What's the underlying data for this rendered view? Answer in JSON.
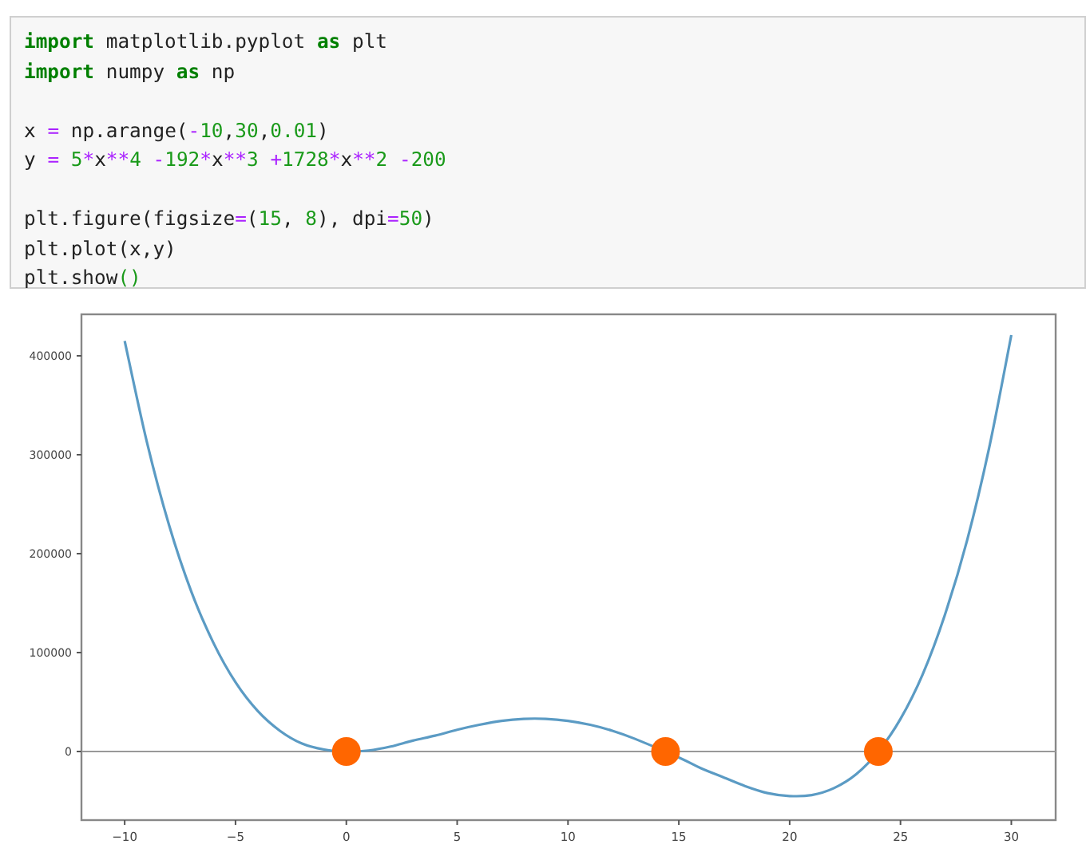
{
  "code_cell": {
    "blocks": [
      [
        [
          {
            "kind": "keyword",
            "text": "import"
          },
          {
            "kind": "plain",
            "text": " matplotlib.pyplot "
          },
          {
            "kind": "keyword",
            "text": "as"
          },
          {
            "kind": "plain",
            "text": " plt"
          }
        ],
        [
          {
            "kind": "keyword",
            "text": "import"
          },
          {
            "kind": "plain",
            "text": " numpy "
          },
          {
            "kind": "keyword",
            "text": "as"
          },
          {
            "kind": "plain",
            "text": " np"
          }
        ]
      ],
      [
        [
          {
            "kind": "plain",
            "text": "x "
          },
          {
            "kind": "operator",
            "text": "="
          },
          {
            "kind": "plain",
            "text": " np.arange("
          },
          {
            "kind": "operator",
            "text": "-"
          },
          {
            "kind": "number",
            "text": "10"
          },
          {
            "kind": "plain",
            "text": ","
          },
          {
            "kind": "number",
            "text": "30"
          },
          {
            "kind": "plain",
            "text": ","
          },
          {
            "kind": "number",
            "text": "0.01"
          },
          {
            "kind": "plain",
            "text": ")"
          }
        ],
        [
          {
            "kind": "plain",
            "text": "y "
          },
          {
            "kind": "operator",
            "text": "="
          },
          {
            "kind": "number",
            "text": " 5"
          },
          {
            "kind": "operator",
            "text": "*"
          },
          {
            "kind": "plain",
            "text": "x"
          },
          {
            "kind": "operator",
            "text": "**"
          },
          {
            "kind": "number",
            "text": "4"
          },
          {
            "kind": "operator",
            "text": " -"
          },
          {
            "kind": "number",
            "text": "192"
          },
          {
            "kind": "operator",
            "text": "*"
          },
          {
            "kind": "plain",
            "text": "x"
          },
          {
            "kind": "operator",
            "text": "**"
          },
          {
            "kind": "number",
            "text": "3"
          },
          {
            "kind": "operator",
            "text": " +"
          },
          {
            "kind": "number",
            "text": "1728"
          },
          {
            "kind": "operator",
            "text": "*"
          },
          {
            "kind": "plain",
            "text": "x"
          },
          {
            "kind": "operator",
            "text": "**"
          },
          {
            "kind": "number",
            "text": "2"
          },
          {
            "kind": "operator",
            "text": " -"
          },
          {
            "kind": "number",
            "text": "200"
          }
        ]
      ],
      [
        [
          {
            "kind": "plain",
            "text": "plt.figure(figsize"
          },
          {
            "kind": "operator",
            "text": "="
          },
          {
            "kind": "plain",
            "text": "("
          },
          {
            "kind": "number",
            "text": "15"
          },
          {
            "kind": "plain",
            "text": ", "
          },
          {
            "kind": "number",
            "text": "8"
          },
          {
            "kind": "plain",
            "text": "), dpi"
          },
          {
            "kind": "operator",
            "text": "="
          },
          {
            "kind": "number",
            "text": "50"
          },
          {
            "kind": "plain",
            "text": ")"
          }
        ],
        [
          {
            "kind": "plain",
            "text": "plt.plot(x,y)"
          }
        ],
        [
          {
            "kind": "plain",
            "text": "plt.show"
          },
          {
            "kind": "bracket",
            "text": "()"
          }
        ]
      ]
    ]
  },
  "output": {
    "chart_data": {
      "type": "line",
      "x": [
        -10,
        -9,
        -8,
        -7,
        -6,
        -5,
        -4,
        -3,
        -2,
        -1,
        0,
        1,
        2,
        3,
        4,
        5,
        6,
        7,
        8,
        9,
        10,
        11,
        12,
        13,
        15,
        16,
        17,
        18,
        19,
        20,
        21,
        22,
        23,
        24,
        25,
        26,
        27,
        28,
        29,
        30
      ],
      "series": [
        {
          "color": "#5b9bc4",
          "values": [
            415000,
            313000,
            229000,
            162000,
            110000,
            70000,
            41000,
            21000,
            8000,
            2000,
            0,
            1000,
            5000,
            11000,
            16000,
            22000,
            27000,
            31000,
            33000,
            33000,
            31000,
            27000,
            21000,
            13000,
            -6000,
            -17000,
            -26000,
            -35000,
            -42000,
            -45000,
            -44000,
            -37000,
            -23000,
            0,
            33000,
            78000,
            138000,
            213000,
            307000,
            421000
          ]
        }
      ],
      "xlim": [
        -11.95,
        32.0
      ],
      "ylim": [
        -69355,
        441935
      ],
      "xticks": [
        {
          "value": -10,
          "label": "−10"
        },
        {
          "value": -5,
          "label": "−5"
        },
        0,
        5,
        10,
        15,
        20,
        25,
        30
      ],
      "yticks": [
        0,
        100000,
        200000,
        300000,
        400000
      ],
      "ref_lines": [
        {
          "axis": "y",
          "value": 0
        }
      ]
    },
    "markers": {
      "chart_data": {
        "type": "scatter",
        "x": [
          0,
          14.4,
          24
        ],
        "series": [
          {
            "color": "#ff6600",
            "values": [
              0,
              0,
              0
            ]
          }
        ],
        "xlim": [
          -11.95,
          32.0
        ],
        "ylim": [
          -69355,
          441935
        ]
      }
    }
  }
}
